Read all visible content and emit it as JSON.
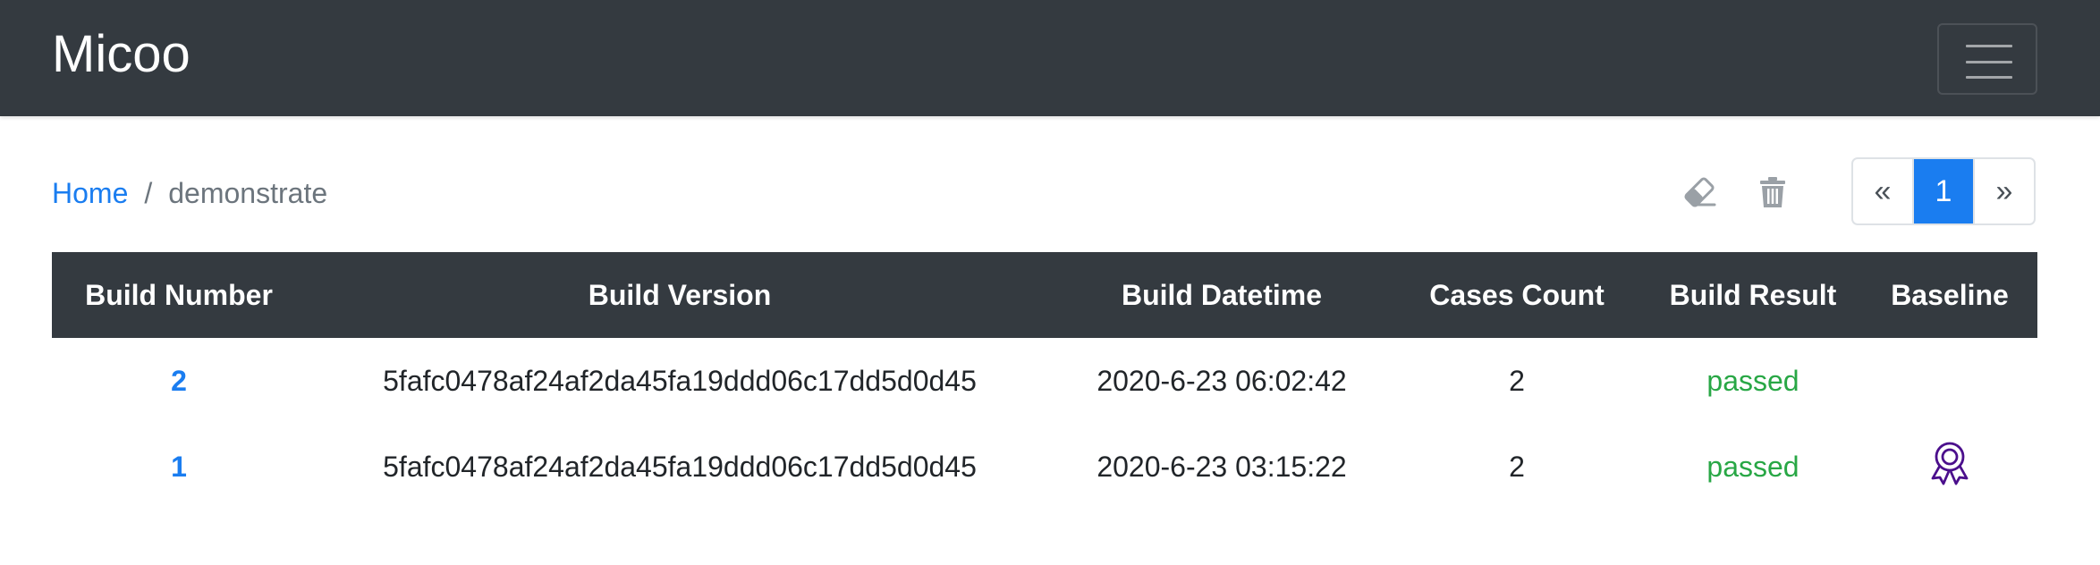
{
  "navbar": {
    "brand": "Micoo"
  },
  "breadcrumb": {
    "home": "Home",
    "separator": "/",
    "current": "demonstrate"
  },
  "toolbar": {
    "icons": [
      "eraser-icon",
      "trash-icon"
    ]
  },
  "pagination": {
    "prev": "«",
    "current": "1",
    "next": "»"
  },
  "table": {
    "headers": [
      "Build Number",
      "Build Version",
      "Build Datetime",
      "Cases Count",
      "Build Result",
      "Baseline"
    ],
    "rows": [
      {
        "number": "2",
        "version": "5fafc0478af24af2da45fa19ddd06c17dd5d0d45",
        "datetime": "2020-6-23 06:02:42",
        "cases": "2",
        "result": "passed",
        "baseline": false
      },
      {
        "number": "1",
        "version": "5fafc0478af24af2da45fa19ddd06c17dd5d0d45",
        "datetime": "2020-6-23 03:15:22",
        "cases": "2",
        "result": "passed",
        "baseline": true
      }
    ]
  },
  "colors": {
    "navbar": "#343a40",
    "link": "#1a7df0",
    "passed": "#28a745",
    "baseline_icon": "#4b0f8c",
    "muted": "#6c757d"
  }
}
